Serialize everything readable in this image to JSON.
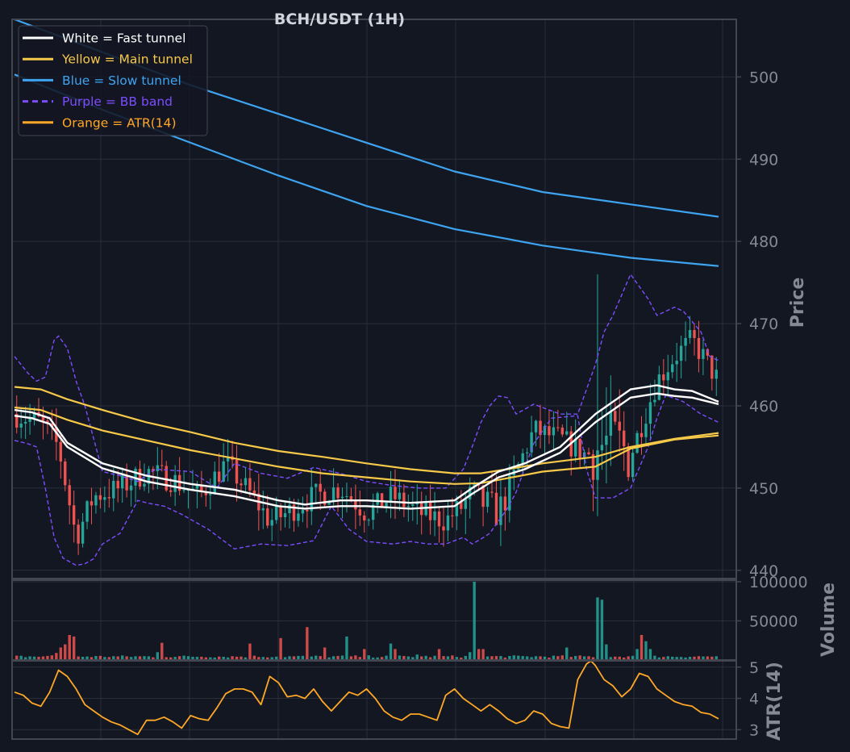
{
  "chart_data": {
    "type": "candlestick",
    "title": "BCH/USDT (1H)",
    "colors": {
      "background": "#131722",
      "frame": "#434651",
      "grid": "#2a2e39",
      "up": "#26a69a",
      "down": "#ef5350",
      "fast": "#ffffff",
      "main": "#f7c948",
      "slow": "#3ea4f0",
      "bb": "#7c4dff",
      "atr": "#ffa726",
      "volume_up": "#26a69a",
      "volume_down": "#ef5350"
    },
    "legend": {
      "position": "top-left",
      "entries": [
        {
          "label": "White = Fast tunnel",
          "color": "#ffffff",
          "dash": false
        },
        {
          "label": "Yellow = Main tunnel",
          "color": "#f7c948",
          "dash": false
        },
        {
          "label": "Blue = Slow tunnel",
          "color": "#3ea4f0",
          "dash": false
        },
        {
          "label": "Purple = BB band",
          "color": "#7c4dff",
          "dash": true
        },
        {
          "label": "Orange = ATR(14)",
          "color": "#ffa726",
          "dash": false
        }
      ]
    },
    "price_panel": {
      "ylabel": "Price",
      "ylim": [
        439,
        507
      ],
      "ticks": [
        440,
        450,
        460,
        470,
        480,
        490,
        500
      ],
      "candles": {
        "count": 160,
        "anchors": [
          [
            0,
            459
          ],
          [
            6,
            458
          ],
          [
            10,
            455
          ],
          [
            14,
            444
          ],
          [
            18,
            449
          ],
          [
            24,
            450
          ],
          [
            30,
            452
          ],
          [
            36,
            451
          ],
          [
            42,
            449
          ],
          [
            48,
            453
          ],
          [
            54,
            449
          ],
          [
            58,
            446
          ],
          [
            62,
            447
          ],
          [
            68,
            449
          ],
          [
            74,
            450
          ],
          [
            80,
            447
          ],
          [
            86,
            449
          ],
          [
            92,
            447
          ],
          [
            98,
            446
          ],
          [
            104,
            449
          ],
          [
            110,
            447
          ],
          [
            114,
            452
          ],
          [
            118,
            457
          ],
          [
            124,
            456
          ],
          [
            130,
            454
          ],
          [
            136,
            456
          ],
          [
            140,
            454
          ],
          [
            146,
            463
          ],
          [
            150,
            466
          ],
          [
            154,
            468
          ],
          [
            160,
            463
          ],
          [
            166,
            458
          ]
        ],
        "high": 476,
        "low": 440
      },
      "fast_upper": {
        "x": [
          0,
          4,
          8,
          12,
          20,
          30,
          40,
          50,
          60,
          66,
          74,
          80,
          90,
          100,
          104,
          110,
          116,
          124,
          132,
          140,
          146,
          150,
          154,
          160
        ],
        "y": [
          459.5,
          459.2,
          458.5,
          455.5,
          453,
          451.5,
          450.5,
          449.8,
          448.5,
          448,
          448.5,
          448.5,
          448.2,
          448.5,
          450,
          452,
          453,
          455,
          459,
          462,
          462.5,
          462,
          461.8,
          460.5
        ]
      },
      "fast_lower": {
        "x": [
          0,
          4,
          8,
          12,
          20,
          30,
          40,
          50,
          60,
          66,
          74,
          80,
          90,
          100,
          104,
          110,
          116,
          124,
          132,
          140,
          146,
          150,
          154,
          160
        ],
        "y": [
          458.8,
          458.5,
          457.8,
          455,
          452.4,
          450.8,
          449.8,
          449,
          447.8,
          447.5,
          447.8,
          447.8,
          447.5,
          447.8,
          449.3,
          451.3,
          452.3,
          454.3,
          458,
          461,
          461.5,
          461.2,
          461,
          460.2
        ]
      },
      "main_upper": {
        "x": [
          0,
          6,
          12,
          20,
          30,
          40,
          50,
          60,
          70,
          80,
          90,
          100,
          106,
          112,
          120,
          132,
          140,
          150,
          160
        ],
        "y": [
          462.3,
          462,
          460.8,
          459.5,
          458,
          456.8,
          455.5,
          454.5,
          453.8,
          453,
          452.3,
          451.8,
          451.8,
          452.3,
          453,
          453.8,
          455,
          456,
          456.7
        ]
      },
      "main_lower": {
        "x": [
          0,
          6,
          12,
          20,
          30,
          40,
          50,
          60,
          70,
          80,
          90,
          100,
          106,
          112,
          120,
          132,
          140,
          150,
          160
        ],
        "y": [
          459.8,
          459.5,
          458.3,
          457,
          455.8,
          454.6,
          453.6,
          452.6,
          451.8,
          451.3,
          450.8,
          450.5,
          450.6,
          451.2,
          452,
          452.6,
          454.8,
          455.9,
          456.4
        ]
      },
      "slow_upper": {
        "x": [
          0,
          20,
          40,
          60,
          80,
          100,
          120,
          140,
          160
        ],
        "y": [
          507,
          503,
          499,
          495.5,
          492,
          488.5,
          486,
          484.5,
          483
        ]
      },
      "slow_lower": {
        "x": [
          0,
          20,
          40,
          60,
          80,
          100,
          120,
          140,
          160
        ],
        "y": [
          500.3,
          496,
          492,
          488,
          484.3,
          481.5,
          479.5,
          478,
          477
        ]
      },
      "bb_upper": {
        "x": [
          0,
          3,
          5,
          7,
          9,
          10,
          12,
          14,
          16,
          18,
          20,
          24,
          28,
          32,
          40,
          46,
          50,
          56,
          62,
          68,
          74,
          80,
          86,
          92,
          98,
          102,
          104,
          106,
          108,
          110,
          112,
          114,
          118,
          124,
          128,
          132,
          134,
          136,
          140,
          144,
          146,
          148,
          150,
          152,
          156,
          158,
          160
        ],
        "y": [
          466,
          464,
          463,
          463.5,
          468,
          468.5,
          467,
          463,
          460,
          456,
          452,
          451.5,
          450.8,
          452.3,
          452,
          450,
          453,
          451.8,
          451.2,
          452.5,
          451.8,
          450.8,
          450.3,
          450,
          450,
          452.3,
          455,
          458,
          460,
          461.2,
          461,
          459,
          460.2,
          459,
          459,
          465,
          469,
          471,
          476,
          473,
          471,
          471.5,
          472,
          471.5,
          469,
          466,
          465.5
        ]
      },
      "bb_lower": {
        "x": [
          0,
          3,
          5,
          7,
          9,
          11,
          14,
          16,
          18,
          20,
          24,
          28,
          30,
          34,
          38,
          44,
          50,
          56,
          62,
          68,
          72,
          76,
          80,
          86,
          90,
          94,
          98,
          102,
          104,
          106,
          108,
          110,
          112,
          114,
          116,
          118,
          122,
          128,
          130,
          132,
          136,
          140,
          144,
          146,
          148,
          152,
          156,
          158,
          160
        ],
        "y": [
          455.8,
          455.4,
          455,
          450,
          444,
          441.5,
          440.6,
          440.8,
          441.4,
          443.2,
          444.5,
          448.5,
          448.2,
          447.8,
          446.8,
          445,
          442.6,
          443.2,
          443,
          443.6,
          447.8,
          445,
          443.5,
          443.2,
          443.5,
          443.2,
          443.2,
          444,
          443.2,
          443.8,
          444.5,
          446,
          447.5,
          449.5,
          452.5,
          455.4,
          458.5,
          458.8,
          452.3,
          448.8,
          448.8,
          450,
          455,
          458.5,
          461.3,
          460.5,
          459,
          458.5,
          458
        ]
      }
    },
    "volume_panel": {
      "ylabel": "Volume",
      "ylim": [
        0,
        102000
      ],
      "ticks": [
        50000,
        100000
      ],
      "baseline": 3000,
      "spikes": [
        [
          8,
          6000
        ],
        [
          9,
          9000
        ],
        [
          10,
          16000
        ],
        [
          11,
          20000
        ],
        [
          12,
          32000
        ],
        [
          13,
          30000
        ],
        [
          32,
          10000
        ],
        [
          33,
          22000
        ],
        [
          53,
          21000
        ],
        [
          60,
          28000
        ],
        [
          66,
          42000
        ],
        [
          70,
          16000
        ],
        [
          75,
          30000
        ],
        [
          79,
          14000
        ],
        [
          85,
          21000
        ],
        [
          86,
          14000
        ],
        [
          91,
          7000
        ],
        [
          96,
          14000
        ],
        [
          103,
          10000
        ],
        [
          104,
          100000
        ],
        [
          105,
          14000
        ],
        [
          106,
          14000
        ],
        [
          125,
          16000
        ],
        [
          132,
          80000
        ],
        [
          133,
          77000
        ],
        [
          134,
          20000
        ],
        [
          141,
          14000
        ],
        [
          142,
          32000
        ],
        [
          143,
          24000
        ],
        [
          144,
          14000
        ]
      ]
    },
    "atr_panel": {
      "ylabel": "ATR(14)",
      "ylim": [
        2.7,
        5.2
      ],
      "ticks": [
        3,
        4,
        5
      ],
      "x": [
        0,
        2,
        4,
        6,
        8,
        10,
        12,
        14,
        16,
        18,
        20,
        22,
        24,
        26,
        28,
        30,
        32,
        34,
        36,
        38,
        40,
        42,
        44,
        46,
        48,
        50,
        52,
        54,
        56,
        58,
        60,
        62,
        64,
        66,
        68,
        70,
        72,
        74,
        76,
        78,
        80,
        82,
        84,
        86,
        88,
        90,
        92,
        94,
        96,
        98,
        100,
        102,
        104,
        106,
        108,
        110,
        112,
        114,
        116,
        118,
        120,
        122,
        124,
        126,
        128,
        130,
        131,
        132,
        134,
        136,
        138,
        140,
        142,
        144,
        146,
        148,
        150,
        152,
        154,
        156,
        158,
        160
      ],
      "y": [
        4.2,
        4.1,
        3.85,
        3.75,
        4.2,
        4.9,
        4.7,
        4.3,
        3.8,
        3.6,
        3.4,
        3.25,
        3.15,
        3,
        2.85,
        3.3,
        3.3,
        3.4,
        3.25,
        3.05,
        3.45,
        3.35,
        3.3,
        3.7,
        4.15,
        4.3,
        4.3,
        4.2,
        3.8,
        4.7,
        4.5,
        4.05,
        4.1,
        4,
        4.3,
        3.9,
        3.6,
        3.9,
        4.2,
        4.1,
        4.3,
        4,
        3.6,
        3.4,
        3.3,
        3.5,
        3.5,
        3.4,
        3.3,
        4.1,
        4.3,
        4.0,
        3.8,
        3.6,
        3.8,
        3.6,
        3.35,
        3.2,
        3.3,
        3.6,
        3.5,
        3.2,
        3.1,
        3.05,
        4.6,
        5.1,
        5.2,
        5.05,
        4.6,
        4.4,
        4.05,
        4.3,
        4.8,
        4.7,
        4.3,
        4.1,
        3.9,
        3.8,
        3.75,
        3.55,
        3.5,
        3.35
      ]
    }
  }
}
